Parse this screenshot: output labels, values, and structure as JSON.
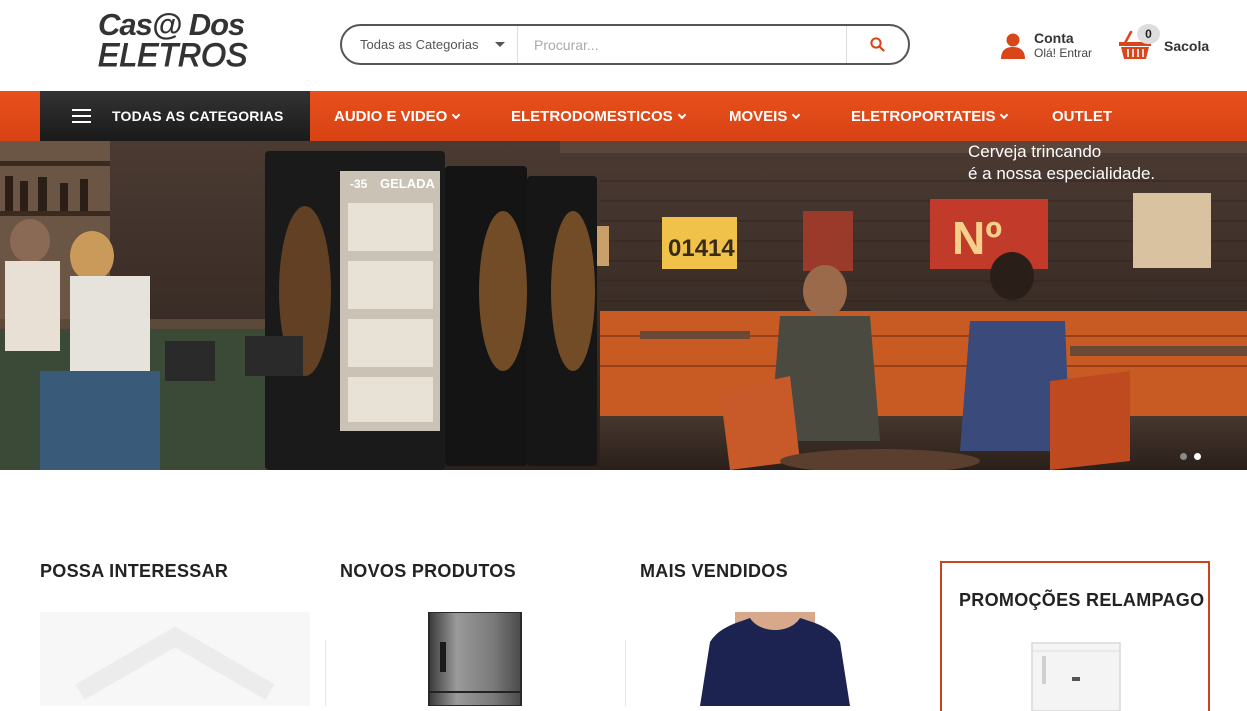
{
  "logo": {
    "line1": "Cas@ Dos",
    "line2": "ELETROS"
  },
  "search": {
    "category_label": "Todas as Categorias",
    "placeholder": "Procurar...",
    "icon": "search-icon"
  },
  "account": {
    "title": "Conta",
    "subtitle": "Olá! Entrar",
    "icon": "user-icon"
  },
  "cart": {
    "count": "0",
    "label": "Sacola",
    "icon": "basket-icon"
  },
  "nav": {
    "all_categories": "TODAS AS CATEGORIAS",
    "items": [
      {
        "label": "AUDIO E VIDEO"
      },
      {
        "label": "ELETRODOMESTICOS"
      },
      {
        "label": "MOVEIS"
      },
      {
        "label": "ELETROPORTATEIS"
      },
      {
        "label": "OUTLET"
      }
    ]
  },
  "banner": {
    "caption_line1": "Cerveja trincando",
    "caption_line2": "é a nossa especialidade.",
    "fridge_label": "GELADA",
    "sign_number": "01414",
    "sign_no": "Nº",
    "fridge_temp": "-35",
    "slides_total": 2,
    "slide_active": 2
  },
  "sections": [
    {
      "title": "POSSA INTERESSAR"
    },
    {
      "title": "NOVOS PRODUTOS"
    },
    {
      "title": "MAIS VENDIDOS"
    },
    {
      "title": "PROMOÇÕES RELAMPAGO"
    }
  ],
  "colors": {
    "accent": "#e04a19",
    "dark": "#222222"
  }
}
